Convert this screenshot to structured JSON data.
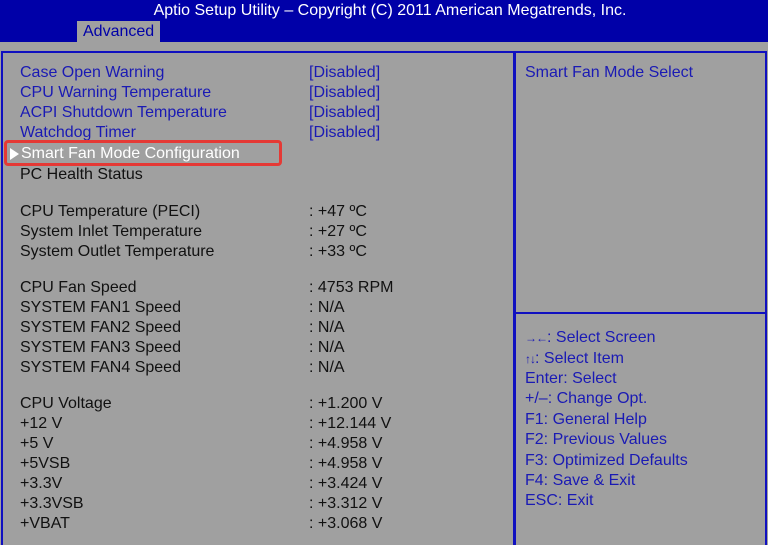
{
  "header": {
    "title": "Aptio Setup Utility – Copyright (C) 2011 American Megatrends, Inc.",
    "active_tab": "Advanced"
  },
  "settings": [
    {
      "label": "Case Open Warning",
      "value": "[Disabled]"
    },
    {
      "label": "CPU Warning Temperature",
      "value": "[Disabled]"
    },
    {
      "label": "ACPI Shutdown Temperature",
      "value": "[Disabled]"
    },
    {
      "label": "Watchdog Timer",
      "value": "[Disabled]"
    }
  ],
  "submenus": [
    {
      "label": "Smart Fan Mode Configuration",
      "selected": true
    },
    {
      "label": "PC Health Status",
      "selected": false
    }
  ],
  "temperatures": [
    {
      "label": "CPU Temperature (PECI)",
      "value": ": +47 ºC"
    },
    {
      "label": "System Inlet Temperature",
      "value": ": +27 ºC"
    },
    {
      "label": "System Outlet Temperature",
      "value": ": +33 ºC"
    }
  ],
  "fans": [
    {
      "label": "CPU Fan Speed",
      "value": ": 4753 RPM"
    },
    {
      "label": "SYSTEM FAN1 Speed",
      "value": ": N/A"
    },
    {
      "label": "SYSTEM FAN2 Speed",
      "value": ": N/A"
    },
    {
      "label": "SYSTEM FAN3 Speed",
      "value": ": N/A"
    },
    {
      "label": "SYSTEM FAN4 Speed",
      "value": ": N/A"
    }
  ],
  "voltages": [
    {
      "label": "CPU Voltage",
      "value": ": +1.200 V"
    },
    {
      "label": "+12 V",
      "value": ": +12.144 V"
    },
    {
      "label": "+5 V",
      "value": ": +4.958 V"
    },
    {
      "label": "+5VSB",
      "value": ": +4.958 V"
    },
    {
      "label": "+3.3V",
      "value": ": +3.424 V"
    },
    {
      "label": "+3.3VSB",
      "value": ": +3.312 V"
    },
    {
      "label": "+VBAT",
      "value": ": +3.068 V"
    }
  ],
  "help": {
    "description": "Smart Fan Mode Select",
    "keys": [
      {
        "glyph": "→←",
        "text": ": Select Screen"
      },
      {
        "glyph": "↑↓",
        "text": ": Select Item"
      },
      {
        "glyph": "",
        "text": "Enter: Select"
      },
      {
        "glyph": "",
        "text": "+/–: Change Opt."
      },
      {
        "glyph": "",
        "text": "F1: General Help"
      },
      {
        "glyph": "",
        "text": "F2: Previous Values"
      },
      {
        "glyph": "",
        "text": "F3: Optimized Defaults"
      },
      {
        "glyph": "",
        "text": "F4: Save & Exit"
      },
      {
        "glyph": "",
        "text": "ESC: Exit"
      }
    ]
  },
  "colors": {
    "header_bg": "#0000a8",
    "panel_bg": "#a0a0a0",
    "accent_text": "#1a1ab4",
    "selection_outline": "#e53935"
  }
}
